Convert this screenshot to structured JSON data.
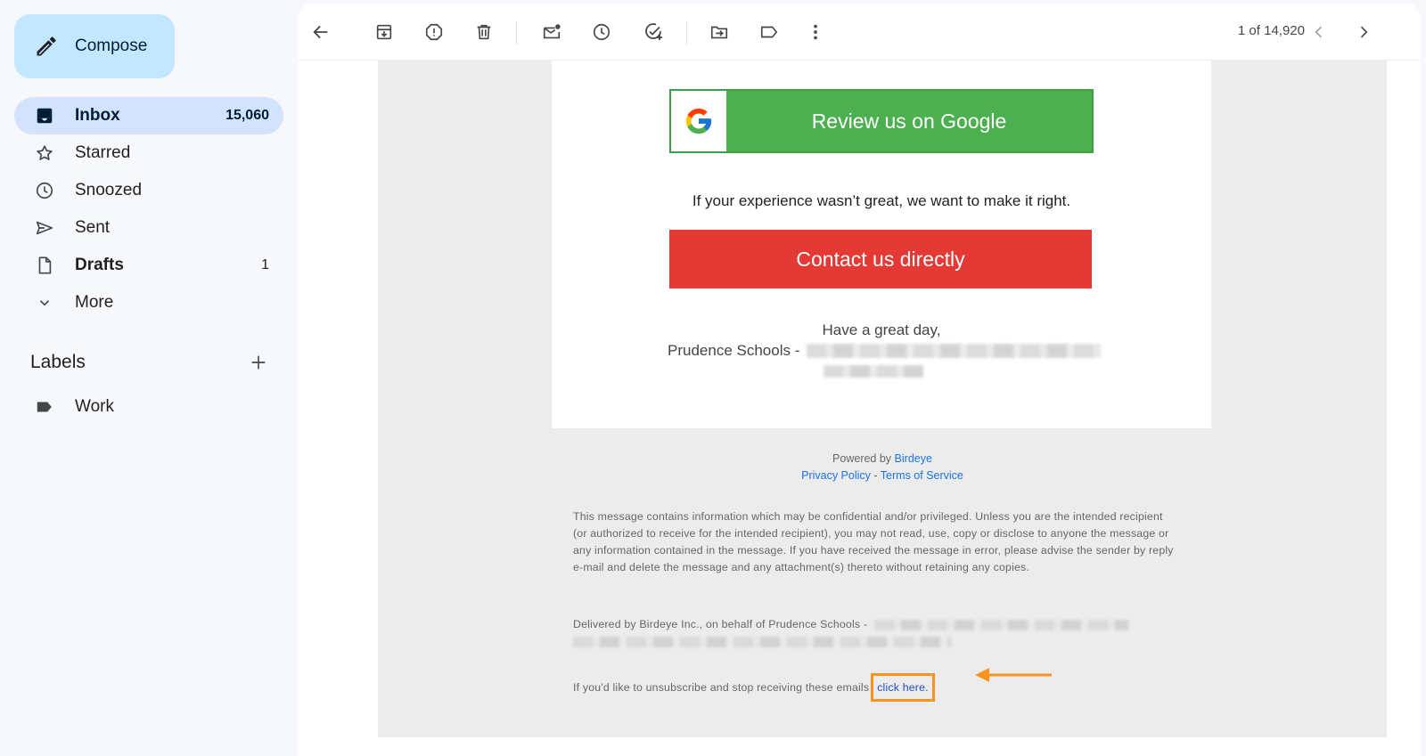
{
  "sidebar": {
    "compose_label": "Compose",
    "items": [
      {
        "label": "Inbox",
        "count": "15,060"
      },
      {
        "label": "Starred",
        "count": ""
      },
      {
        "label": "Snoozed",
        "count": ""
      },
      {
        "label": "Sent",
        "count": ""
      },
      {
        "label": "Drafts",
        "count": "1"
      },
      {
        "label": "More",
        "count": ""
      }
    ],
    "labels_title": "Labels",
    "labels": [
      {
        "label": "Work"
      }
    ]
  },
  "toolbar": {
    "icons": [
      "back-arrow-icon",
      "archive-icon",
      "report-spam-icon",
      "delete-icon",
      "mark-unread-icon",
      "snooze-icon",
      "add-task-icon",
      "move-to-icon",
      "label-icon",
      "more-vert-icon"
    ],
    "pager": "1 of 14,920"
  },
  "email": {
    "review_button": "Review us on Google",
    "experience_text": "If your experience wasn’t great, we want to make it right.",
    "contact_button": "Contact us directly",
    "sign_off": "Have a great day,",
    "sender": "Prudence Schools -",
    "powered_by": "Powered by",
    "powered_brand": "Birdeye",
    "privacy_link": "Privacy Policy",
    "link_sep": " - ",
    "terms_link": "Terms of Service",
    "disclaimer": "This message contains information which may be confidential and/or privileged. Unless you are the intended recipient (or authorized to receive for the intended recipient), you may not read, use, copy or disclose to anyone the message or any information contained in the message. If you have received the message in error, please advise the sender by reply e-mail and delete the message and any attachment(s) thereto without retaining any copies.",
    "delivered": "Delivered by Birdeye Inc., on behalf of Prudence Schools -",
    "unsubscribe_text": "If you'd like to unsubscribe and stop receiving these emails",
    "unsubscribe_link": "click here."
  },
  "colors": {
    "accent_compose": "#c2e7ff",
    "active_nav": "#d3e3fd",
    "review_green": "#4caf50",
    "contact_red": "#e53935",
    "highlight_orange": "#f7931e",
    "link_blue": "#1a73e8"
  }
}
